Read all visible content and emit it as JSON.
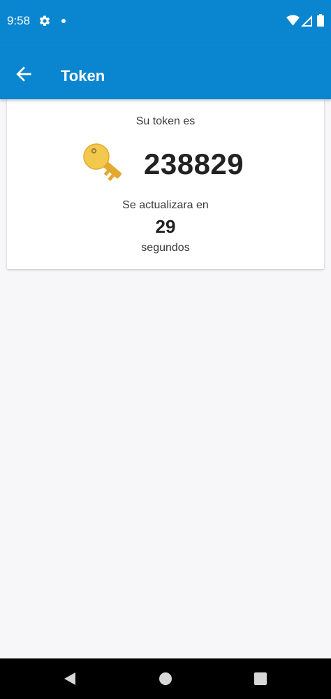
{
  "status_bar": {
    "time": "9:58",
    "icons": [
      "gear-icon",
      "notification-dot-icon",
      "wifi-icon",
      "signal-icon",
      "battery-icon"
    ]
  },
  "app_bar": {
    "title": "Token",
    "back_icon": "arrow-back-icon",
    "color": "#0a86d0"
  },
  "token_card": {
    "prompt": "Su token es",
    "icon": "key-icon",
    "token": "238829",
    "refresh_label": "Se actualizara en",
    "seconds": "29",
    "seconds_unit": "segundos"
  },
  "nav_bar": {
    "buttons": [
      "back-triangle-icon",
      "home-circle-icon",
      "recents-square-icon"
    ]
  },
  "colors": {
    "accent": "#0a86d0",
    "background": "#f7f7f9",
    "key": "#f2c94c"
  }
}
